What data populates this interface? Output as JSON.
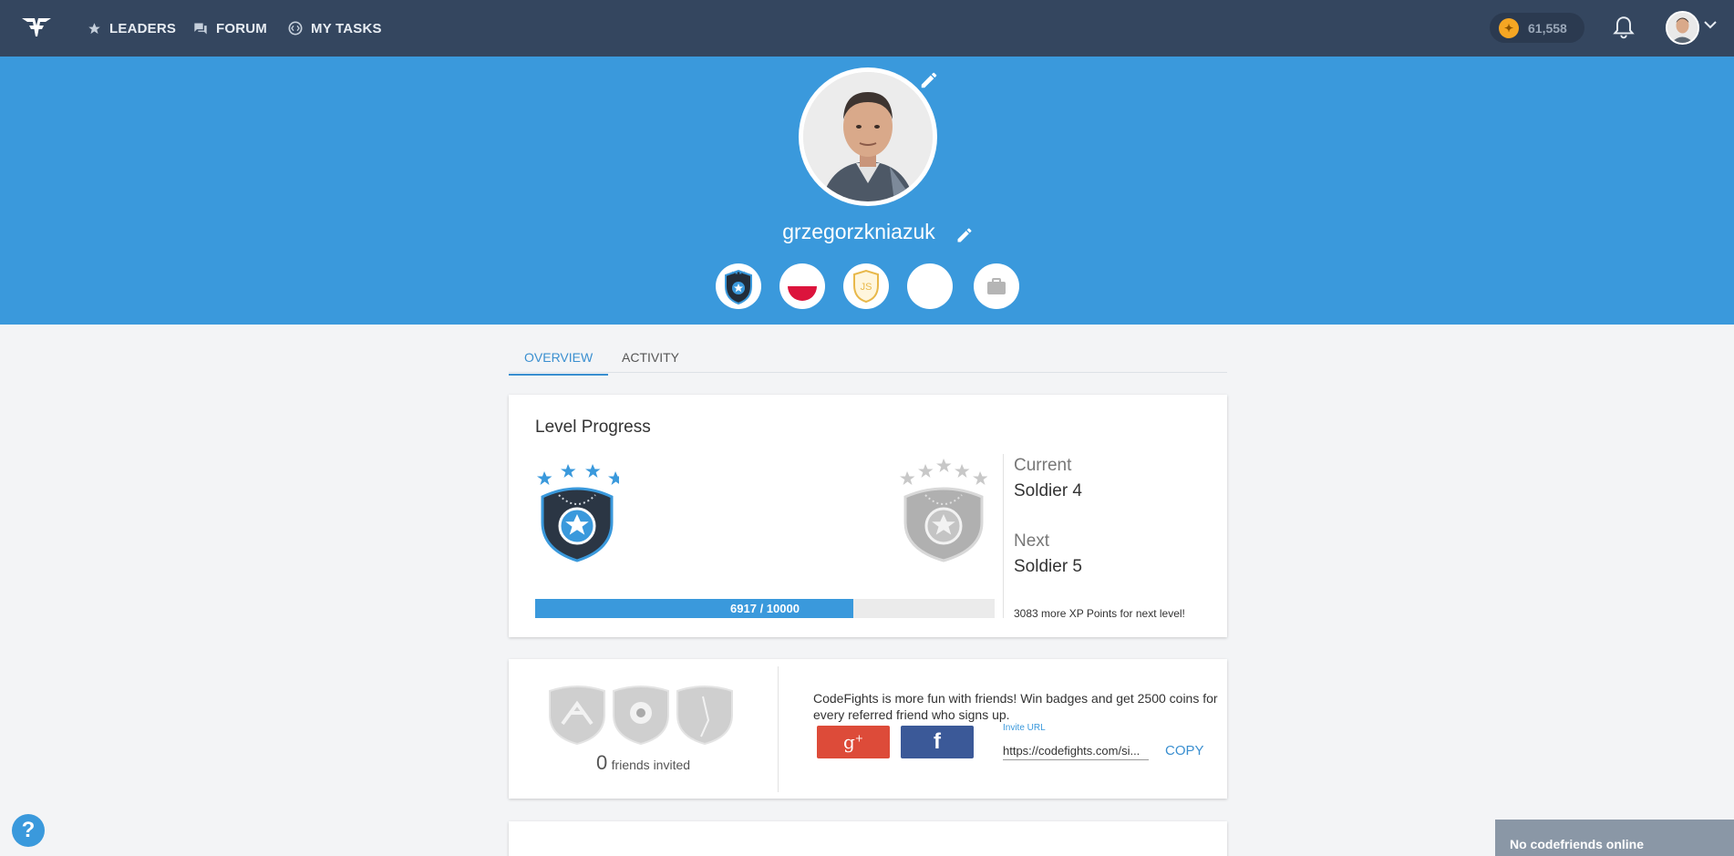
{
  "nav": {
    "items": [
      {
        "label": "LEADERS",
        "icon": "star-icon"
      },
      {
        "label": "FORUM",
        "icon": "forum-icon"
      },
      {
        "label": "MY TASKS",
        "icon": "tasks-icon"
      }
    ],
    "coins": "61,558"
  },
  "profile": {
    "username": "grzegorzkniazuk",
    "badges": [
      "soldier-badge-icon",
      "poland-flag-icon",
      "javascript-badge-icon",
      "empty-badge-icon",
      "briefcase-icon"
    ]
  },
  "tabs": {
    "overview": "OVERVIEW",
    "activity": "ACTIVITY"
  },
  "level": {
    "title": "Level Progress",
    "current_label": "Current",
    "current_value": "Soldier 4",
    "next_label": "Next",
    "next_value": "Soldier 5",
    "progress_text": "6917 / 10000",
    "progress_fraction": 0.6917,
    "xp_note": "3083 more XP Points for next level!"
  },
  "friends": {
    "count": "0",
    "label": "friends invited",
    "invite_text": "CodeFights is more fun with friends! Win badges and get 2500 coins for every referred friend who signs up.",
    "invite_url_label": "Invite URL",
    "invite_url": "https://codefights.com/si...",
    "copy": "COPY"
  },
  "footer": {
    "online": "No codefriends online",
    "help": "?"
  },
  "colors": {
    "nav": "#34465f",
    "hero": "#3a99dc",
    "accent": "#3a99dc",
    "gplus": "#dd4b39",
    "facebook": "#3b5998"
  }
}
